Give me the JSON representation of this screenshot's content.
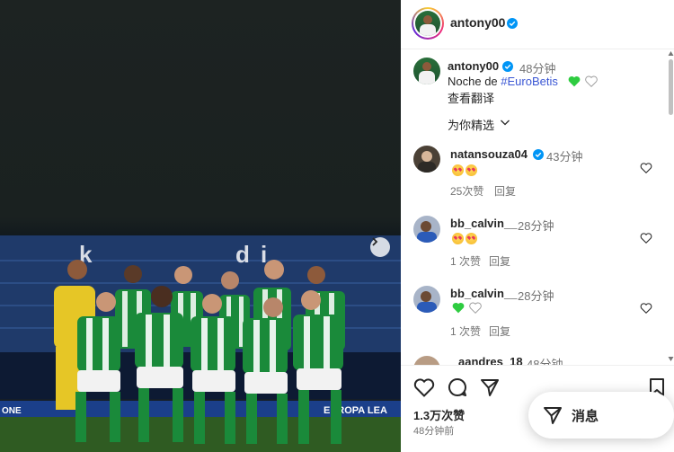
{
  "post": {
    "username": "antony00",
    "image": {
      "stadium_letters": [
        "k",
        "d",
        "i"
      ],
      "banner_text": "EUROPA LEA",
      "banner_left": "ONE"
    }
  },
  "caption": {
    "username": "antony00",
    "time": "48分钟",
    "text_prefix": "Noche de ",
    "hashtag": "#EuroBetis",
    "translate": "查看翻译"
  },
  "filter_label": "为你精选",
  "comments": [
    {
      "username": "natansouza04",
      "verified": true,
      "time": "43分钟",
      "emoji_count": 2,
      "likes": "25次赞",
      "reply": "回复"
    },
    {
      "username": "bb_calvin__",
      "verified": false,
      "time": "28分钟",
      "emoji_count": 2,
      "likes": "1 次赞",
      "reply": "回复"
    },
    {
      "username": "bb_calvin__",
      "verified": false,
      "time": "28分钟",
      "emoji_count": 0,
      "likes": "1 次赞",
      "reply": "回复"
    },
    {
      "username": "aandres_18",
      "verified": false,
      "time": "48分钟"
    }
  ],
  "footer": {
    "likes_count": "1.3万次赞",
    "post_time": "48分钟前"
  },
  "messages_button": {
    "label": "消息"
  },
  "colors": {
    "verified_blue": "#0095f6",
    "link_blue": "#00376b",
    "green_heart": "#2ecc40",
    "betis_green": "#1a8a3a",
    "keeper_yellow": "#e6c626"
  }
}
